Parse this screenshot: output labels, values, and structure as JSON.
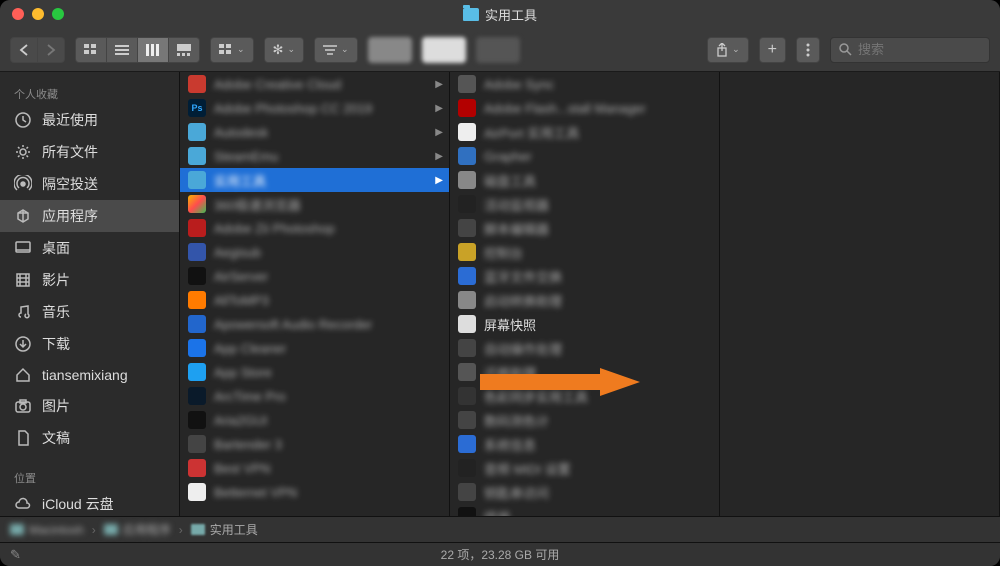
{
  "window": {
    "title": "实用工具"
  },
  "search": {
    "placeholder": "搜索"
  },
  "sidebar": {
    "section1_label": "个人收藏",
    "items": [
      {
        "label": "最近使用",
        "icon": "clock"
      },
      {
        "label": "所有文件",
        "icon": "gear"
      },
      {
        "label": "隔空投送",
        "icon": "airdrop"
      },
      {
        "label": "应用程序",
        "icon": "apps",
        "selected": true
      },
      {
        "label": "桌面",
        "icon": "desktop"
      },
      {
        "label": "影片",
        "icon": "movie"
      },
      {
        "label": "音乐",
        "icon": "music"
      },
      {
        "label": "下载",
        "icon": "download"
      },
      {
        "label": "tiansemixiang",
        "icon": "home"
      },
      {
        "label": "图片",
        "icon": "camera"
      },
      {
        "label": "文稿",
        "icon": "doc"
      }
    ],
    "section2_label": "位置",
    "items2": [
      {
        "label": "iCloud 云盘",
        "icon": "cloud"
      }
    ]
  },
  "col1": [
    {
      "label": "Adobe Creative Cloud",
      "ic": "ic-cc",
      "blur": true,
      "arrow": true
    },
    {
      "label": "Adobe Photoshop CC 2019",
      "ic": "ic-ps",
      "blur": true,
      "arrow": true,
      "badge": "Ps"
    },
    {
      "label": "Autodesk",
      "ic": "ic-folder",
      "blur": true,
      "arrow": true
    },
    {
      "label": "SteamEmu",
      "ic": "ic-folder",
      "blur": true,
      "arrow": true
    },
    {
      "label": "实用工具",
      "ic": "ic-folder",
      "blur": true,
      "arrow": true,
      "selected": true
    },
    {
      "label": "360极速浏览器",
      "ic": "ic-360",
      "blur": true
    },
    {
      "label": "Adobe Zii Photoshop",
      "ic": "ic-zii",
      "blur": true
    },
    {
      "label": "Aegisub",
      "ic": "ic-aeg",
      "blur": true
    },
    {
      "label": "AirServer",
      "ic": "ic-air",
      "blur": true
    },
    {
      "label": "AllToMP3",
      "ic": "ic-mp3",
      "blur": true
    },
    {
      "label": "Apowersoft Audio Recorder",
      "ic": "ic-mic",
      "blur": true
    },
    {
      "label": "App Cleaner",
      "ic": "ic-clean",
      "blur": true
    },
    {
      "label": "App Store",
      "ic": "ic-store",
      "blur": true
    },
    {
      "label": "ArcTime Pro",
      "ic": "ic-arc",
      "blur": true
    },
    {
      "label": "Aria2GUI",
      "ic": "ic-aria",
      "blur": true
    },
    {
      "label": "Bartender 3",
      "ic": "ic-bart",
      "blur": true
    },
    {
      "label": "Best VPN",
      "ic": "ic-vpn",
      "blur": true
    },
    {
      "label": "Betternet VPN",
      "ic": "ic-bn",
      "blur": true
    }
  ],
  "col2": [
    {
      "label": "Adobe Sync",
      "ic": "ic-gen",
      "blur": true
    },
    {
      "label": "Adobe Flash...stall Manager",
      "ic": "ic-flash",
      "blur": true
    },
    {
      "label": "AirPort 实用工具",
      "ic": "ic-wifi",
      "blur": true
    },
    {
      "label": "Grapher",
      "ic": "ic-graph",
      "blur": true
    },
    {
      "label": "磁盘工具",
      "ic": "ic-disk",
      "blur": true
    },
    {
      "label": "活动监视器",
      "ic": "ic-act",
      "blur": true
    },
    {
      "label": "脚本编辑器",
      "ic": "ic-script",
      "blur": true
    },
    {
      "label": "控制台",
      "ic": "ic-term",
      "blur": true
    },
    {
      "label": "蓝牙文件交换",
      "ic": "ic-bt",
      "blur": true
    },
    {
      "label": "启动转换助理",
      "ic": "ic-migr",
      "blur": true
    },
    {
      "label": "屏幕快照",
      "ic": "ic-screenshot",
      "blur": false,
      "highlight": true
    },
    {
      "label": "自动操作处理",
      "ic": "ic-autom",
      "blur": true
    },
    {
      "label": "迁移助理",
      "ic": "ic-gen",
      "blur": true
    },
    {
      "label": "色彩同步实用工具",
      "ic": "ic-colorsync",
      "blur": true
    },
    {
      "label": "数码测色计",
      "ic": "ic-digi",
      "blur": true
    },
    {
      "label": "系统信息",
      "ic": "ic-sysinfo",
      "blur": true
    },
    {
      "label": "音频 MIDI 设置",
      "ic": "ic-midi",
      "blur": true
    },
    {
      "label": "钥匙串访问",
      "ic": "ic-keychain",
      "blur": true
    },
    {
      "label": "终端",
      "ic": "ic-term2",
      "blur": true
    }
  ],
  "pathbar": [
    {
      "label": "Macintosh",
      "blur": true
    },
    {
      "label": "应用程序",
      "blur": true
    },
    {
      "label": "实用工具",
      "blur": false
    }
  ],
  "status": {
    "text": "22 项，23.28 GB 可用"
  }
}
